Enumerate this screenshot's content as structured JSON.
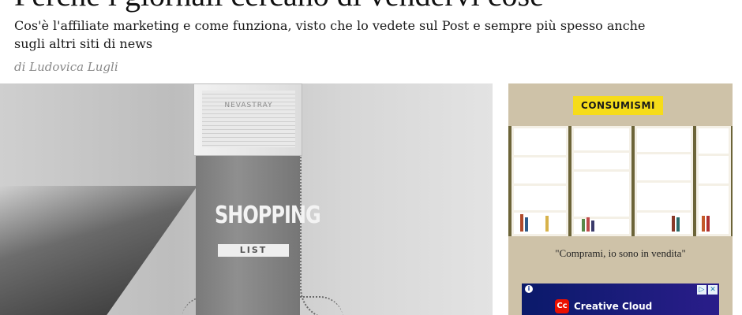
{
  "article": {
    "headline": "Perché i giornali cercano di vendervi cose",
    "subtitle": "Cos'è l'affiliate marketing e come funziona, visto che lo vedete sul Post e sempre più spesso anche sugli altri siti di news",
    "byline": "di Ludovica Lugli"
  },
  "hero_image": {
    "box_brand": "NEVASTRAY",
    "label_main": "SHOPPING",
    "label_sub": "LIST"
  },
  "sidebar": {
    "tag": "CONSUMISMI",
    "quote": "\"Comprami, io sono in vendita\"",
    "ad": {
      "info_icon": "info-icon",
      "logo_icon": "creative-cloud-logo-icon",
      "text": "Creative Cloud",
      "choices_icon": "ad-choices-icon",
      "close_icon": "close-icon"
    }
  },
  "colors": {
    "tag_background": "#f6dc1a",
    "sidebar_background": "#cec2a8",
    "ad_background": "#0a1a6a"
  }
}
